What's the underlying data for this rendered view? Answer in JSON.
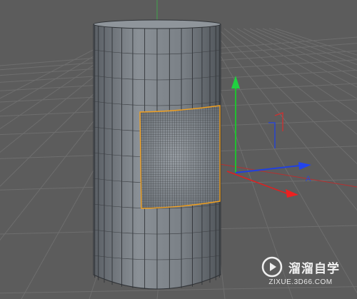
{
  "viewport": {
    "background_color": "#5c5c5c",
    "grid_color": "#6e6e6e",
    "object": "cylinder",
    "mesh_color": "#6f757c",
    "selection_color": "#f0a020",
    "axis_colors": {
      "x": "#e02020",
      "y": "#20c030",
      "z": "#2040e0"
    },
    "axis_labels": {
      "x": "A",
      "z": "A"
    }
  },
  "watermark": {
    "title": "溜溜自学",
    "url": "ZIXUE.3D66.COM",
    "logo_icon": "play-logo-icon"
  }
}
